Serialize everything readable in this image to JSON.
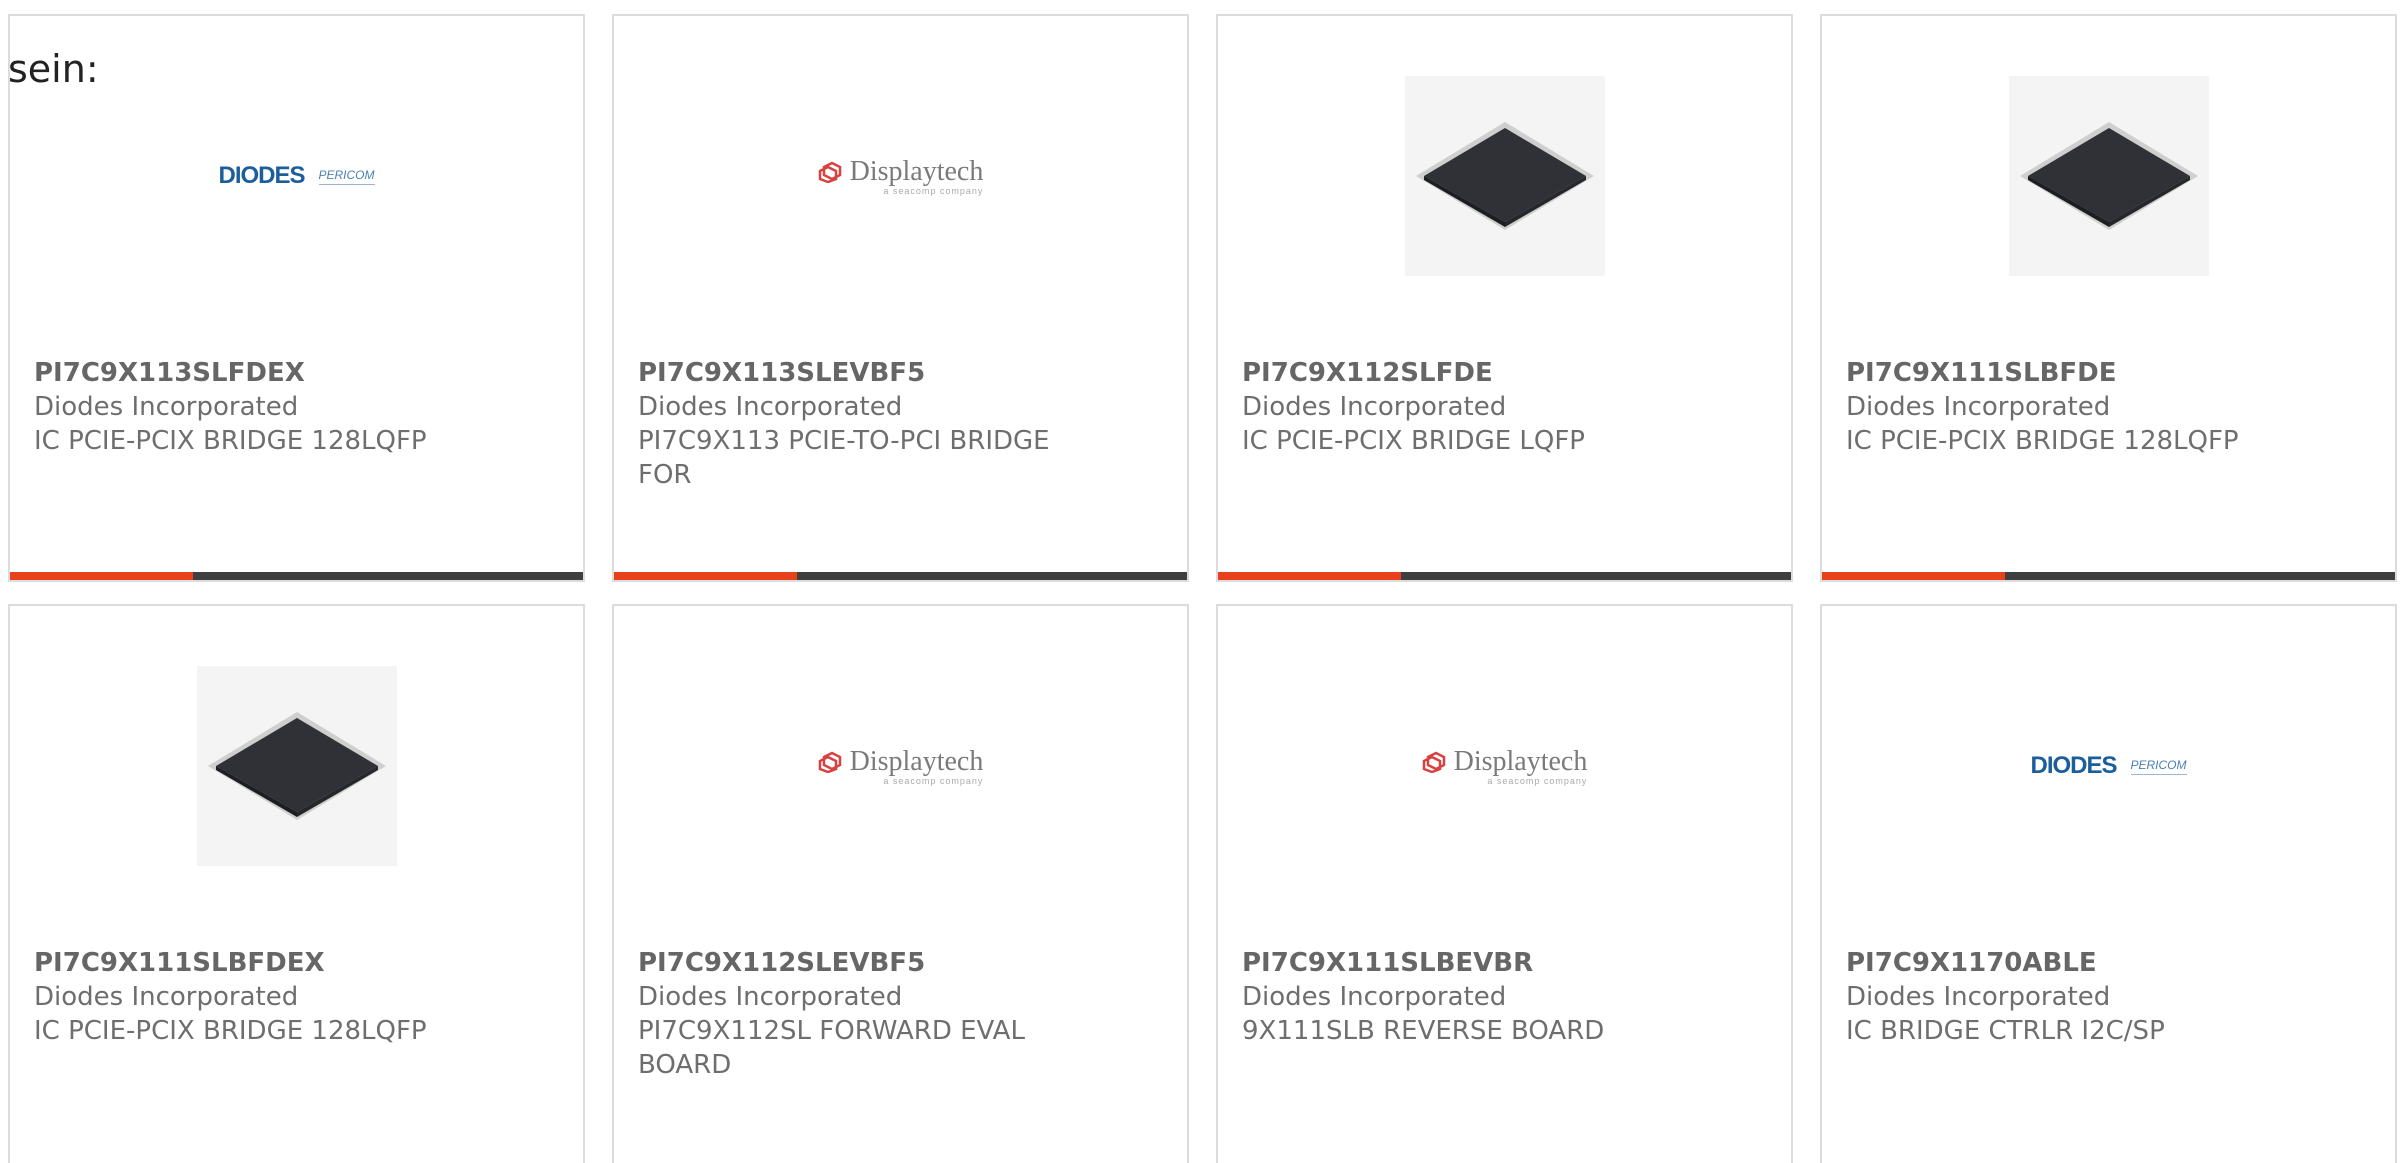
{
  "intro": {
    "text": "sein:"
  },
  "products": [
    {
      "part_number": "PI7C9X113SLFDEX",
      "manufacturer": "Diodes Incorporated",
      "description": "IC PCIE-PCIX BRIDGE 128LQFP",
      "image": "diodes-pericom-logo",
      "logo_text": "DIODES",
      "logo_sub": "PERICOM"
    },
    {
      "part_number": "PI7C9X113SLEVBF5",
      "manufacturer": "Diodes Incorporated",
      "description": "PI7C9X113 PCIE-TO-PCI BRIDGE FOR",
      "image": "displaytech-logo",
      "logo_text": "Displaytech",
      "logo_sub": "a seacomp company"
    },
    {
      "part_number": "PI7C9X112SLFDE",
      "manufacturer": "Diodes Incorporated",
      "description": "IC PCIE-PCIX BRIDGE LQFP",
      "image": "lqfp-chip-photo"
    },
    {
      "part_number": "PI7C9X111SLBFDE",
      "manufacturer": "Diodes Incorporated",
      "description": "IC PCIE-PCIX BRIDGE 128LQFP",
      "image": "lqfp-chip-photo"
    },
    {
      "part_number": "PI7C9X111SLBFDEX",
      "manufacturer": "Diodes Incorporated",
      "description": "IC PCIE-PCIX BRIDGE 128LQFP",
      "image": "lqfp-chip-photo"
    },
    {
      "part_number": "PI7C9X112SLEVBF5",
      "manufacturer": "Diodes Incorporated",
      "description": "PI7C9X112SL FORWARD EVAL BOARD",
      "image": "displaytech-logo",
      "logo_text": "Displaytech",
      "logo_sub": "a seacomp company"
    },
    {
      "part_number": "PI7C9X111SLBEVBR",
      "manufacturer": "Diodes Incorporated",
      "description": "9X111SLB REVERSE BOARD",
      "image": "displaytech-logo",
      "logo_text": "Displaytech",
      "logo_sub": "a seacomp company"
    },
    {
      "part_number": "PI7C9X1170ABLE",
      "manufacturer": "Diodes Incorporated",
      "description": "IC BRIDGE CTRLR I2C/SP",
      "image": "diodes-pericom-logo",
      "logo_text": "DIODES",
      "logo_sub": "PERICOM"
    }
  ],
  "colors": {
    "accent": "#e8401c",
    "bar": "#3f3f3f",
    "border": "#dcdcdc",
    "text": "#666666",
    "diodes_blue": "#1c5e9c",
    "displaytech_red": "#d94040"
  }
}
